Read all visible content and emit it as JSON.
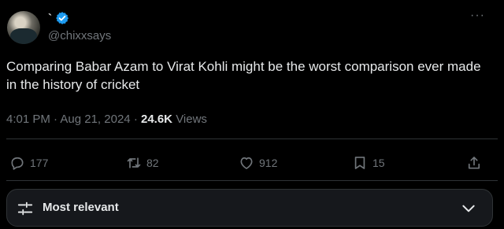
{
  "author": {
    "display_name": "`",
    "handle": "@chixxsays",
    "verified": true
  },
  "tweet": {
    "text": "Comparing Babar Azam to Virat Kohli might be the worst comparison ever made in the history of cricket",
    "time": "4:01 PM",
    "separator": "·",
    "date": "Aug 21, 2024",
    "views_count": "24.6K",
    "views_label": "Views"
  },
  "actions": {
    "replies": "177",
    "reposts": "82",
    "likes": "912",
    "bookmarks": "15"
  },
  "sort": {
    "label": "Most relevant"
  },
  "colors": {
    "background": "#000000",
    "text": "#e7e9ea",
    "muted": "#71767b",
    "verified": "#1d9bf0",
    "border": "#2f3336"
  }
}
